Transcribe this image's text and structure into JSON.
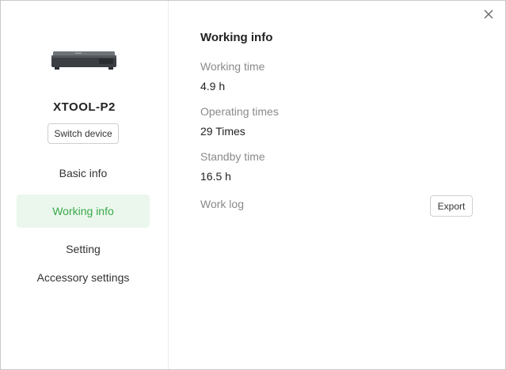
{
  "sidebar": {
    "device_name": "XTOOL-P2",
    "switch_device_label": "Switch device",
    "nav": {
      "basic_info": "Basic info",
      "working_info": "Working info",
      "setting": "Setting",
      "accessory_settings": "Accessory settings"
    },
    "active_item": "Working info",
    "active_color": "#3aa94a",
    "active_bg": "#ebf7ed"
  },
  "main": {
    "title": "Working info",
    "working_time": {
      "label": "Working time",
      "value": "4.9 h"
    },
    "operating_times": {
      "label": "Operating times",
      "value": "29 Times"
    },
    "standby_time": {
      "label": "Standby time",
      "value": "16.5 h"
    },
    "work_log": {
      "label": "Work log",
      "export_label": "Export"
    }
  },
  "icons": {
    "close": "close-icon",
    "device": "laser-engraver-device-image"
  }
}
